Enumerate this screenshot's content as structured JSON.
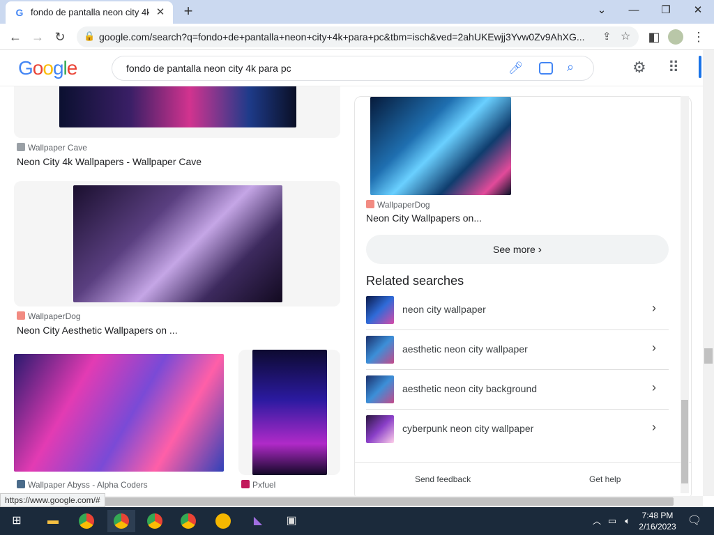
{
  "browser": {
    "tab_title": "fondo de pantalla neon city 4k pa",
    "tab_favicon": "G",
    "url": "google.com/search?q=fondo+de+pantalla+neon+city+4k+para+pc&tbm=isch&ved=2ahUKEwjj3Yvw0Zv9AhXG..."
  },
  "google": {
    "logo": [
      "G",
      "o",
      "o",
      "g",
      "l",
      "e"
    ],
    "query": "fondo de pantalla neon city 4k para pc"
  },
  "results": [
    {
      "source": "Wallpaper Cave",
      "title": "Neon City 4k Wallpapers - Wallpaper Cave",
      "icon_color": "#9aa0a6"
    },
    {
      "source": "WallpaperDog",
      "title": "Neon City Aesthetic Wallpapers on ...",
      "icon_color": "#f28b82"
    },
    {
      "source": "Wallpaper Abyss - Alpha Coders",
      "icon_color": "#4a6b8a"
    },
    {
      "source": "Pxfuel",
      "icon_color": "#c2185b"
    }
  ],
  "panel": {
    "result": {
      "source": "WallpaperDog",
      "title": "Neon City Wallpapers on..."
    },
    "see_more": "See more",
    "related_title": "Related searches",
    "related": [
      "neon city wallpaper",
      "aesthetic neon city wallpaper",
      "aesthetic neon city background",
      "cyberpunk neon city wallpaper"
    ],
    "send_feedback": "Send feedback",
    "get_help": "Get help"
  },
  "status_url": "https://www.google.com/#",
  "taskbar": {
    "time": "7:48 PM",
    "date": "2/16/2023",
    "colors": {
      "bg": "#1b2a3b"
    }
  }
}
